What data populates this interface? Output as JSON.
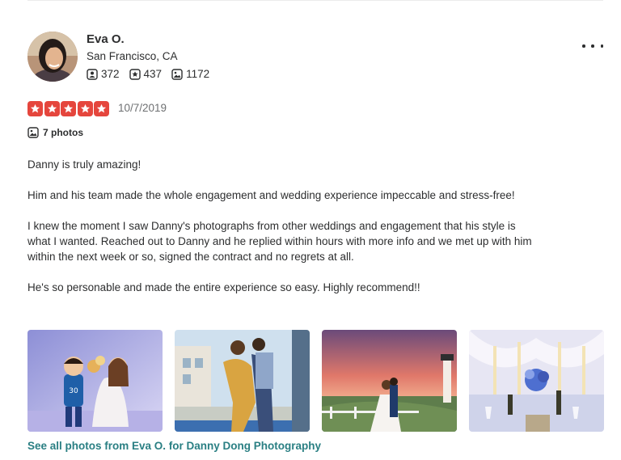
{
  "review": {
    "user": {
      "name": "Eva O.",
      "location": "San Francisco, CA",
      "friends": "372",
      "reviews": "437",
      "photos": "1172"
    },
    "rating": 5,
    "date": "10/7/2019",
    "photos_label": "7 photos",
    "paragraphs": [
      "Danny is truly amazing!",
      "Him and his team made the whole engagement and wedding experience impeccable and stress-free!",
      "I knew the moment I saw Danny's photographs from other weddings and engagement that his style is what I wanted. Reached out to Danny and he replied within hours with more info and we met up with him within the next week or so, signed the contract and no regrets at all.",
      "He's so personable and made the entire experience so easy. Highly recommend!!"
    ],
    "see_all_link": "See all photos from Eva O. for Danny Dong Photography"
  },
  "colors": {
    "star": "#e5463d",
    "link": "#2a7f83",
    "text": "#2d2e2f",
    "muted": "#6e7072"
  },
  "icons": {
    "friends": "friends-icon",
    "reviews": "review-star-icon",
    "photos": "photo-icon",
    "more": "more-options-icon"
  }
}
